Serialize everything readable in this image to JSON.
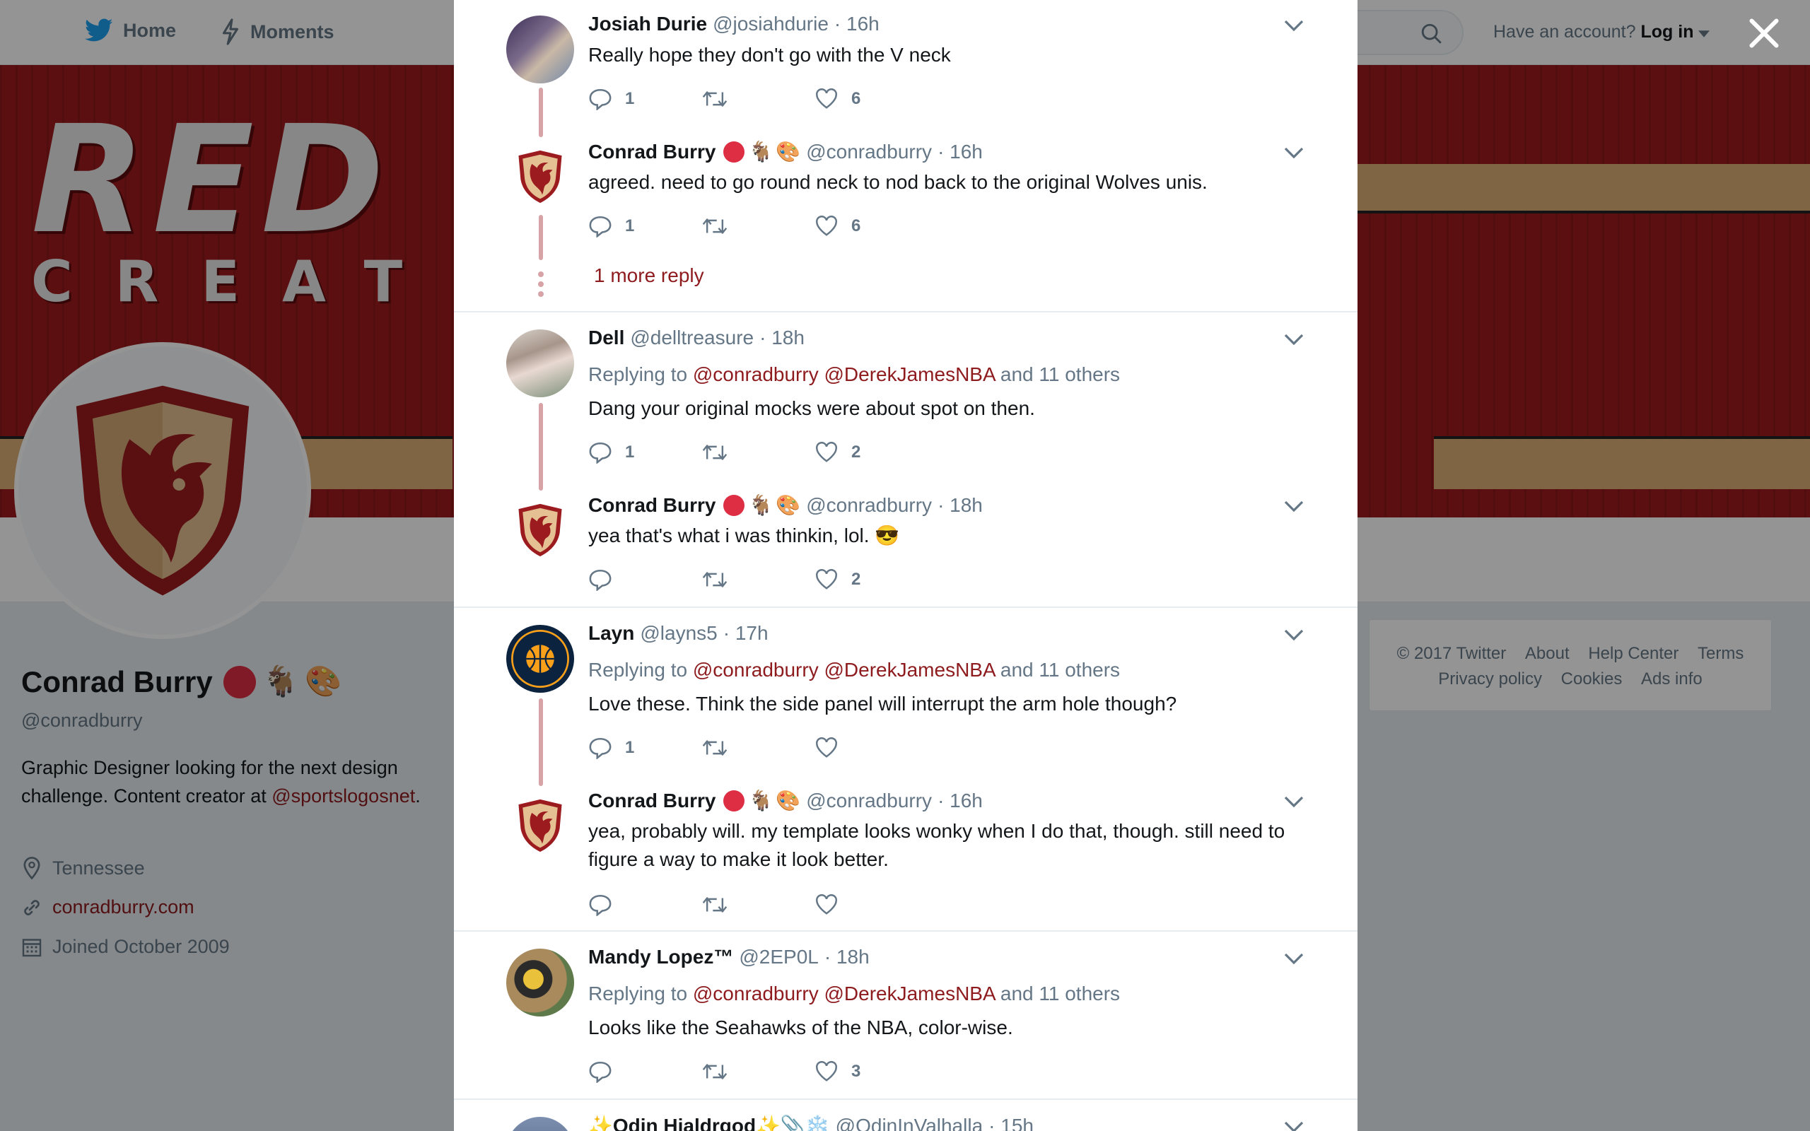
{
  "nav": {
    "home": "Home",
    "moments": "Moments",
    "login_prompt": "Have an account?",
    "login": "Log in"
  },
  "banner": {
    "line1": "RED G",
    "line2": "CREAT"
  },
  "profile": {
    "name": "Conrad Burry",
    "handle": "@conradburry",
    "bio_text": "Graphic Designer looking for the next design challenge. Content creator at ",
    "bio_link": "@sportslogosnet",
    "bio_end": ".",
    "location": "Tennessee",
    "website": "conradburry.com",
    "joined": "Joined October 2009"
  },
  "footer": {
    "row1": [
      "© 2017 Twitter",
      "About",
      "Help Center",
      "Terms"
    ],
    "row2": [
      "Privacy policy",
      "Cookies",
      "Ads info"
    ]
  },
  "colors": {
    "accent": "#8e1b1e",
    "thread": "#d7a3a6",
    "muted": "#657786"
  },
  "tweets": [
    {
      "name": "Josiah Durie",
      "handle": "@josiahdurie",
      "time": "· 16h",
      "text": "Really hope they don't go with the V neck",
      "replies": "1",
      "retweets": "",
      "likes": "6"
    },
    {
      "name": "Conrad Burry",
      "handle": "@conradburry",
      "time": "· 16h",
      "text": "agreed. need to go round neck to nod back to the original Wolves unis.",
      "replies": "1",
      "retweets": "",
      "likes": "6"
    },
    {
      "name": "Dell",
      "handle": "@delltreasure",
      "time": "· 18h",
      "text": "Dang your original mocks were about spot on then.",
      "replies": "1",
      "retweets": "",
      "likes": "2"
    },
    {
      "name": "Conrad Burry",
      "handle": "@conradburry",
      "time": "· 18h",
      "text": "yea that's what i was thinkin, lol. 😎",
      "replies": "",
      "retweets": "",
      "likes": "2"
    },
    {
      "name": "Layn",
      "handle": "@layns5",
      "time": "· 17h",
      "text": "Love these. Think the side panel will interrupt the arm hole though?",
      "replies": "1",
      "retweets": "",
      "likes": ""
    },
    {
      "name": "Conrad Burry",
      "handle": "@conradburry",
      "time": "· 16h",
      "text": "yea, probably will. my template looks wonky when I do that, though. still need to figure a way to make it look better.",
      "replies": "",
      "retweets": "",
      "likes": ""
    },
    {
      "name": "Mandy Lopez™",
      "handle": "@2EP0L",
      "time": "· 18h",
      "text": "Looks like the Seahawks of the NBA, color-wise.",
      "replies": "",
      "retweets": "",
      "likes": "3"
    },
    {
      "name": "✨Odin Hjaldrgod✨📎❄️",
      "handle": "@OdinInValhalla",
      "time": "· 15h"
    }
  ],
  "replying": {
    "prefix": "Replying to",
    "m1": "@conradburry",
    "m2": "@DerekJamesNBA",
    "suffix": "and 11 others"
  },
  "more_reply": "1 more reply",
  "emoji": {
    "goat": "🐐",
    "palette": "🎨"
  }
}
